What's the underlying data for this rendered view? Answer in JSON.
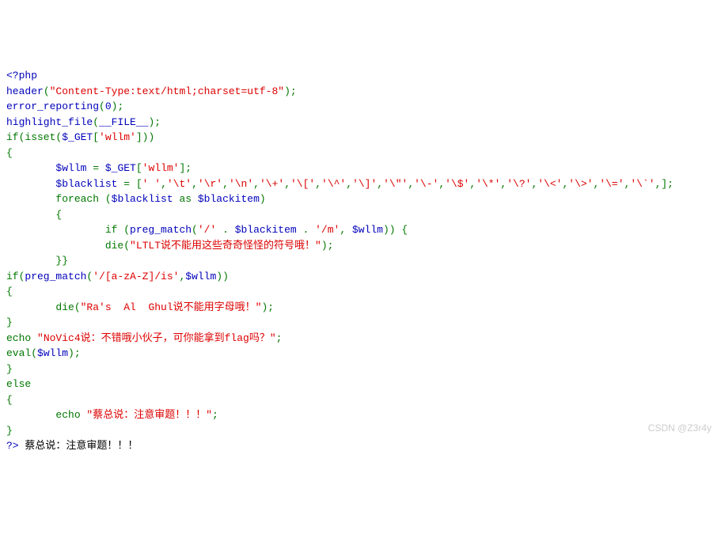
{
  "lines": [
    [
      {
        "t": "<?php",
        "c": "#0000BB"
      }
    ],
    [
      {
        "t": "header",
        "c": "#0000BB"
      },
      {
        "t": "(",
        "c": "#007700"
      },
      {
        "t": "\"Content-Type:text/html;charset=utf-8\"",
        "c": "#DD0000"
      },
      {
        "t": ");",
        "c": "#007700"
      }
    ],
    [
      {
        "t": "error_reporting",
        "c": "#0000BB"
      },
      {
        "t": "(",
        "c": "#007700"
      },
      {
        "t": "0",
        "c": "#0000BB"
      },
      {
        "t": ");",
        "c": "#007700"
      }
    ],
    [
      {
        "t": "highlight_file",
        "c": "#0000BB"
      },
      {
        "t": "(",
        "c": "#007700"
      },
      {
        "t": "__FILE__",
        "c": "#0000BB"
      },
      {
        "t": ");",
        "c": "#007700"
      }
    ],
    [
      {
        "t": "if(isset(",
        "c": "#007700"
      },
      {
        "t": "$_GET",
        "c": "#0000BB"
      },
      {
        "t": "[",
        "c": "#007700"
      },
      {
        "t": "'wllm'",
        "c": "#DD0000"
      },
      {
        "t": "]))",
        "c": "#007700"
      }
    ],
    [
      {
        "t": "{",
        "c": "#007700"
      }
    ],
    [
      {
        "t": "        ",
        "c": "#000"
      },
      {
        "t": "$wllm ",
        "c": "#0000BB"
      },
      {
        "t": "= ",
        "c": "#007700"
      },
      {
        "t": "$_GET",
        "c": "#0000BB"
      },
      {
        "t": "[",
        "c": "#007700"
      },
      {
        "t": "'wllm'",
        "c": "#DD0000"
      },
      {
        "t": "];",
        "c": "#007700"
      }
    ],
    [
      {
        "t": "        ",
        "c": "#000"
      },
      {
        "t": "$blacklist ",
        "c": "#0000BB"
      },
      {
        "t": "= [",
        "c": "#007700"
      },
      {
        "t": "' '",
        "c": "#DD0000"
      },
      {
        "t": ",",
        "c": "#007700"
      },
      {
        "t": "'\\t'",
        "c": "#DD0000"
      },
      {
        "t": ",",
        "c": "#007700"
      },
      {
        "t": "'\\r'",
        "c": "#DD0000"
      },
      {
        "t": ",",
        "c": "#007700"
      },
      {
        "t": "'\\n'",
        "c": "#DD0000"
      },
      {
        "t": ",",
        "c": "#007700"
      },
      {
        "t": "'\\+'",
        "c": "#DD0000"
      },
      {
        "t": ",",
        "c": "#007700"
      },
      {
        "t": "'\\['",
        "c": "#DD0000"
      },
      {
        "t": ",",
        "c": "#007700"
      },
      {
        "t": "'\\^'",
        "c": "#DD0000"
      },
      {
        "t": ",",
        "c": "#007700"
      },
      {
        "t": "'\\]'",
        "c": "#DD0000"
      },
      {
        "t": ",",
        "c": "#007700"
      },
      {
        "t": "'\\\"'",
        "c": "#DD0000"
      },
      {
        "t": ",",
        "c": "#007700"
      },
      {
        "t": "'\\-'",
        "c": "#DD0000"
      },
      {
        "t": ",",
        "c": "#007700"
      },
      {
        "t": "'\\$'",
        "c": "#DD0000"
      },
      {
        "t": ",",
        "c": "#007700"
      },
      {
        "t": "'\\*'",
        "c": "#DD0000"
      },
      {
        "t": ",",
        "c": "#007700"
      },
      {
        "t": "'\\?'",
        "c": "#DD0000"
      },
      {
        "t": ",",
        "c": "#007700"
      },
      {
        "t": "'\\<'",
        "c": "#DD0000"
      },
      {
        "t": ",",
        "c": "#007700"
      },
      {
        "t": "'\\>'",
        "c": "#DD0000"
      },
      {
        "t": ",",
        "c": "#007700"
      },
      {
        "t": "'\\='",
        "c": "#DD0000"
      },
      {
        "t": ",",
        "c": "#007700"
      },
      {
        "t": "'\\`'",
        "c": "#DD0000"
      },
      {
        "t": ",];",
        "c": "#007700"
      }
    ],
    [
      {
        "t": "        ",
        "c": "#000"
      },
      {
        "t": "foreach (",
        "c": "#007700"
      },
      {
        "t": "$blacklist ",
        "c": "#0000BB"
      },
      {
        "t": "as ",
        "c": "#007700"
      },
      {
        "t": "$blackitem",
        "c": "#0000BB"
      },
      {
        "t": ")",
        "c": "#007700"
      }
    ],
    [
      {
        "t": "        {",
        "c": "#007700"
      }
    ],
    [
      {
        "t": "                if (",
        "c": "#007700"
      },
      {
        "t": "preg_match",
        "c": "#0000BB"
      },
      {
        "t": "(",
        "c": "#007700"
      },
      {
        "t": "'/' ",
        "c": "#DD0000"
      },
      {
        "t": ". ",
        "c": "#007700"
      },
      {
        "t": "$blackitem ",
        "c": "#0000BB"
      },
      {
        "t": ". ",
        "c": "#007700"
      },
      {
        "t": "'/m'",
        "c": "#DD0000"
      },
      {
        "t": ", ",
        "c": "#007700"
      },
      {
        "t": "$wllm",
        "c": "#0000BB"
      },
      {
        "t": ")) {",
        "c": "#007700"
      }
    ],
    [
      {
        "t": "                die(",
        "c": "#007700"
      },
      {
        "t": "\"LTLT说不能用这些奇奇怪怪的符号哦！\"",
        "c": "#DD0000"
      },
      {
        "t": ");",
        "c": "#007700"
      }
    ],
    [
      {
        "t": "        }}",
        "c": "#007700"
      }
    ],
    [
      {
        "t": "if(",
        "c": "#007700"
      },
      {
        "t": "preg_match",
        "c": "#0000BB"
      },
      {
        "t": "(",
        "c": "#007700"
      },
      {
        "t": "'/[a-zA-Z]/is'",
        "c": "#DD0000"
      },
      {
        "t": ",",
        "c": "#007700"
      },
      {
        "t": "$wllm",
        "c": "#0000BB"
      },
      {
        "t": "))",
        "c": "#007700"
      }
    ],
    [
      {
        "t": "{",
        "c": "#007700"
      }
    ],
    [
      {
        "t": "        die(",
        "c": "#007700"
      },
      {
        "t": "\"Ra's  Al  Ghul说不能用字母哦！\"",
        "c": "#DD0000"
      },
      {
        "t": ");",
        "c": "#007700"
      }
    ],
    [
      {
        "t": "}",
        "c": "#007700"
      }
    ],
    [
      {
        "t": "echo ",
        "c": "#007700"
      },
      {
        "t": "\"NoVic4说：不错哦小伙子，可你能拿到flag吗？\"",
        "c": "#DD0000"
      },
      {
        "t": ";",
        "c": "#007700"
      }
    ],
    [
      {
        "t": "eval(",
        "c": "#007700"
      },
      {
        "t": "$wllm",
        "c": "#0000BB"
      },
      {
        "t": ");",
        "c": "#007700"
      }
    ],
    [
      {
        "t": "}",
        "c": "#007700"
      }
    ],
    [
      {
        "t": "else",
        "c": "#007700"
      }
    ],
    [
      {
        "t": "{",
        "c": "#007700"
      }
    ],
    [
      {
        "t": "        echo ",
        "c": "#007700"
      },
      {
        "t": "\"蔡总说：注意审题！！！\"",
        "c": "#DD0000"
      },
      {
        "t": ";",
        "c": "#007700"
      }
    ],
    [
      {
        "t": "}",
        "c": "#007700"
      }
    ],
    [
      {
        "t": "?> ",
        "c": "#0000BB"
      },
      {
        "t": "蔡总说：注意审题！！！",
        "c": "#000000"
      }
    ]
  ],
  "watermark": "CSDN @Z3r4y"
}
